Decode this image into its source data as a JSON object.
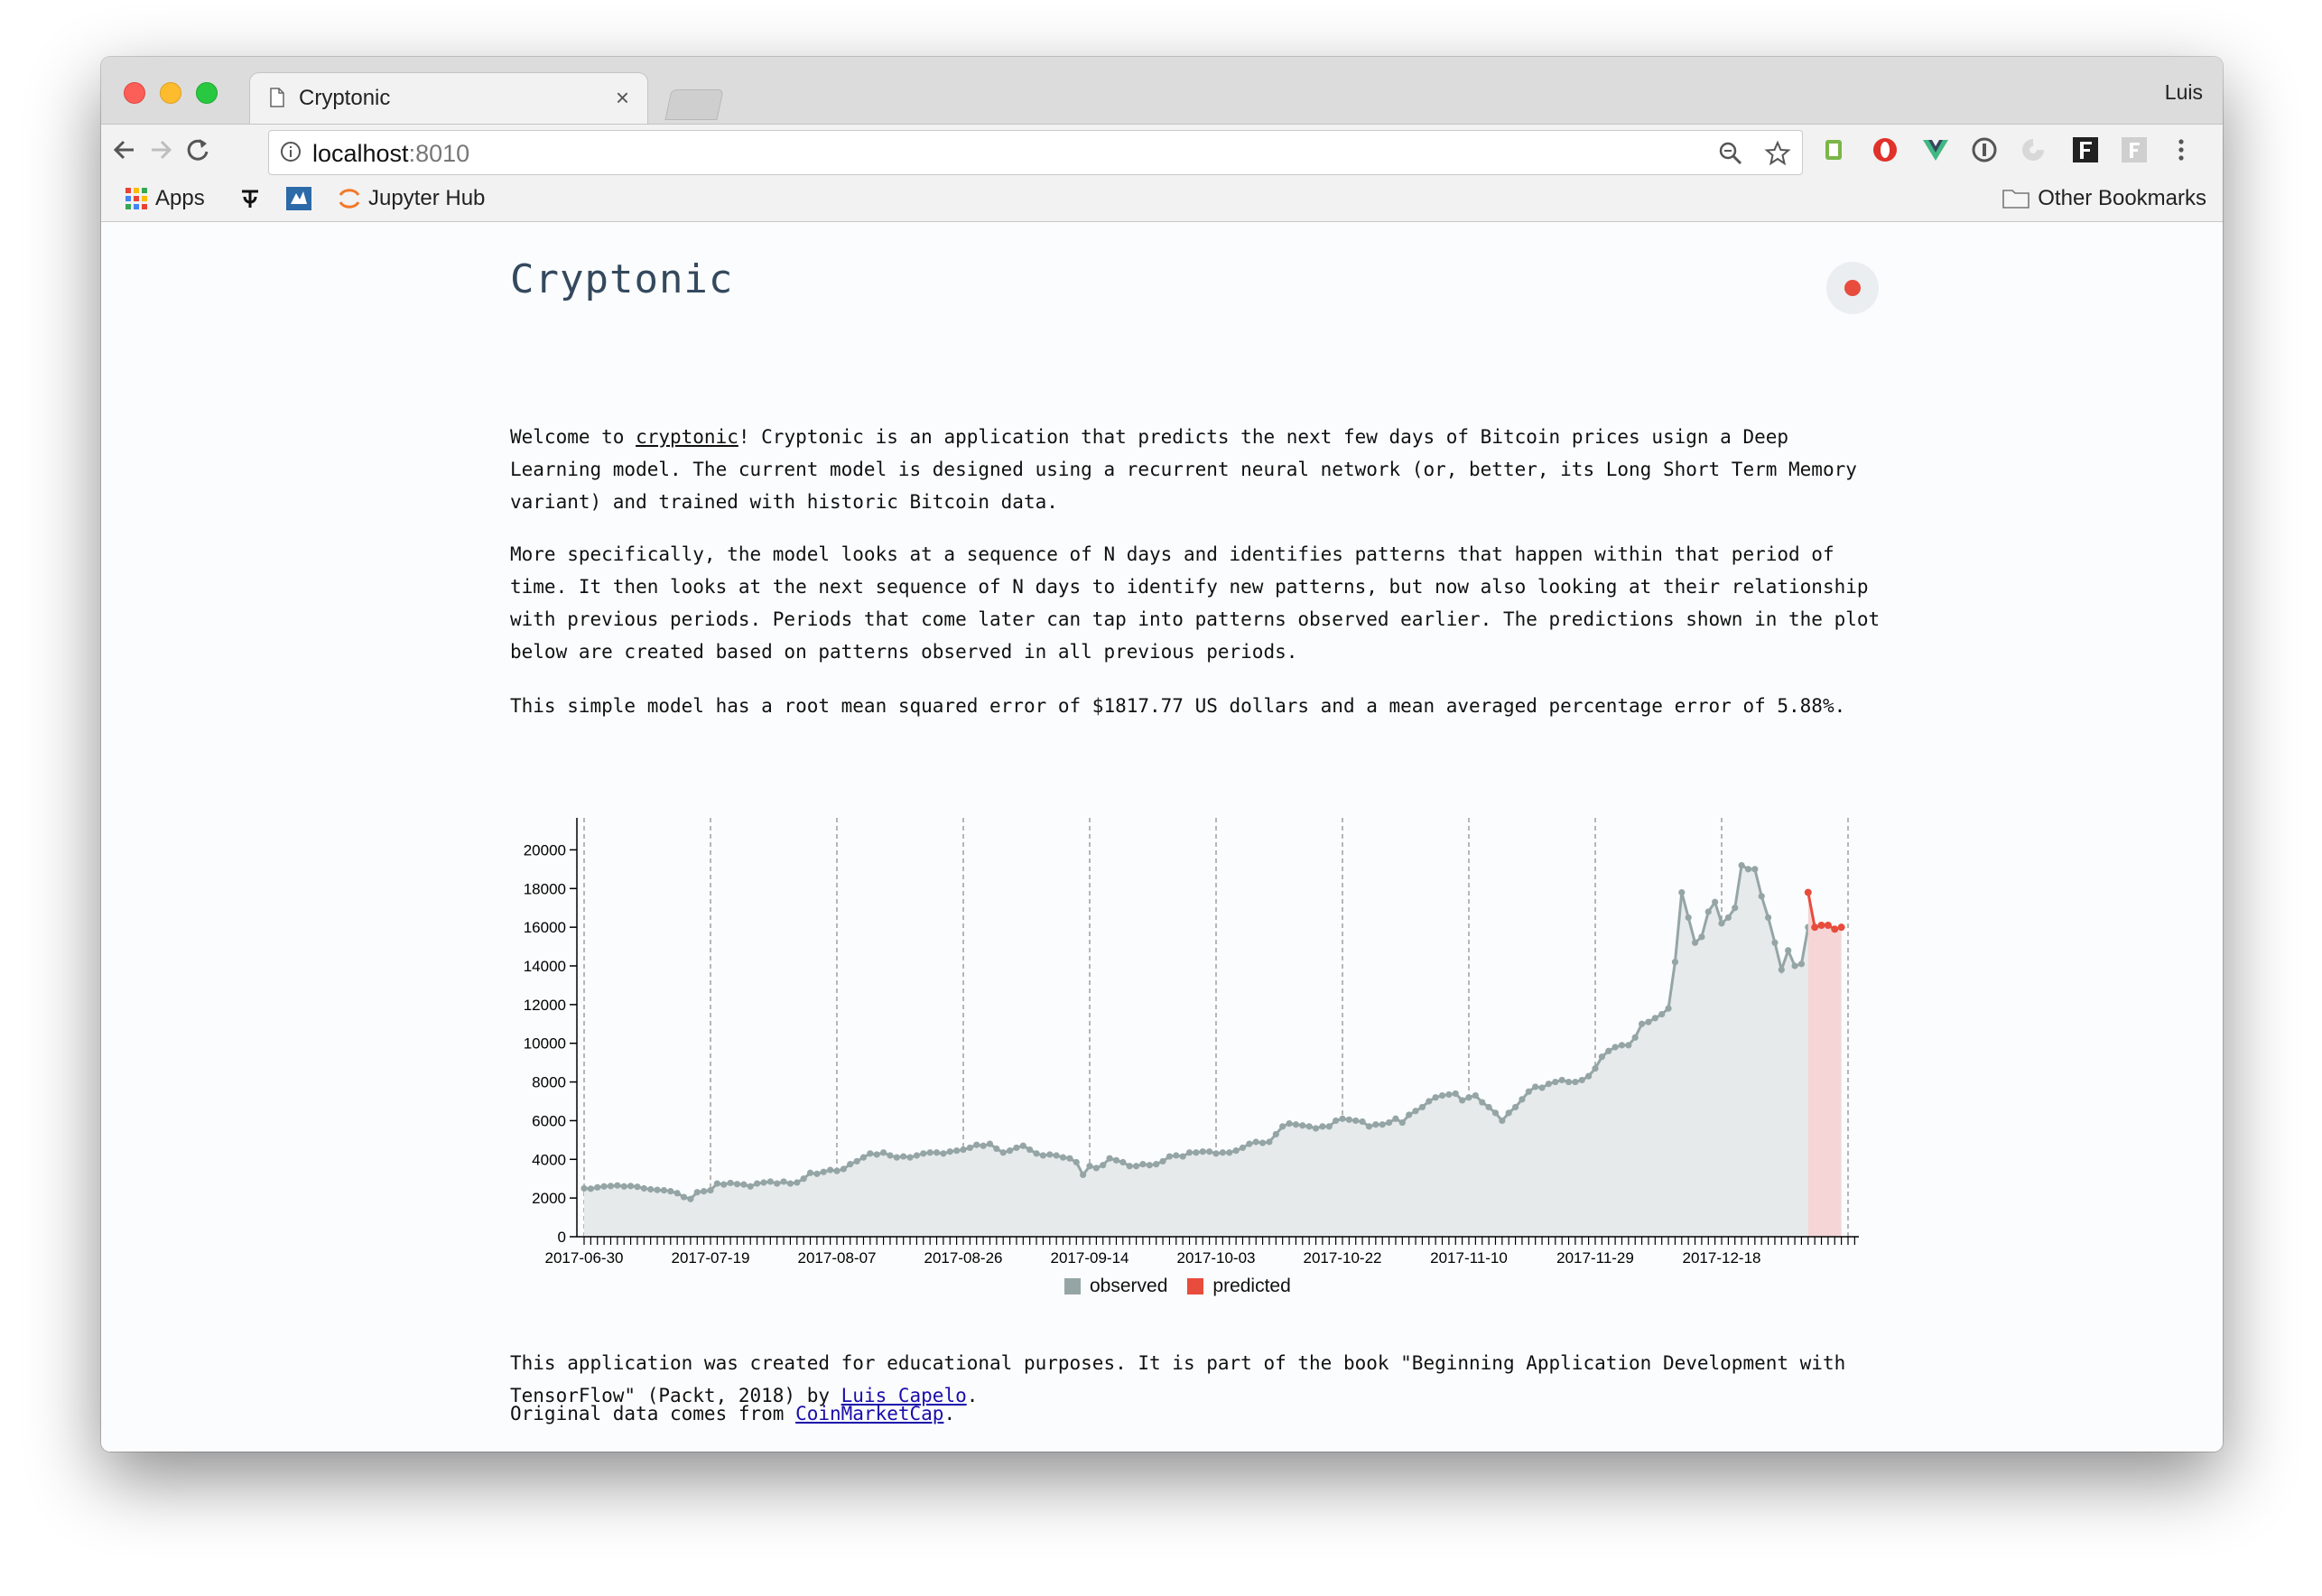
{
  "browser": {
    "tab_title": "Cryptonic",
    "tab_close": "×",
    "profile": "Luis",
    "url_host": "localhost",
    "url_port": ":8010",
    "bookmarks": {
      "apps": "Apps",
      "jupyter": "Jupyter Hub",
      "other": "Other Bookmarks"
    }
  },
  "page": {
    "title": "Cryptonic",
    "p1_welcome": "Welcome to ",
    "p1_link": "cryptonic",
    "p1_rest": "! Cryptonic is an application that predicts the next few days of Bitcoin prices usign a Deep Learning model. The current model is designed using a recurrent neural network (or, better, its Long Short Term Memory variant) and trained with historic Bitcoin data.",
    "p2": "More specifically, the model looks at a sequence of N days and identifies patterns that happen within that period of time. It then looks at the next sequence of N days to identify new patterns, but now also looking at their relationship with previous periods. Periods that come later can tap into patterns observed earlier. The predictions shown in the plot below are created based on patterns observed in all previous periods.",
    "p3": "This simple model has a root mean squared error of $1817.77 US dollars and a mean averaged percentage error of 5.88%.",
    "p4_text": "This application was created for educational purposes. It is part of the book \"Beginning Application Development with TensorFlow\" (Packt, 2018) by ",
    "p4_link": "Luis Capelo",
    "p4_end": ".",
    "p5_text": "Original data comes from ",
    "p5_link": "CoinMarketCap",
    "p5_end": "."
  },
  "chart_data": {
    "type": "area",
    "ylim": [
      0,
      21000
    ],
    "yticks": [
      0,
      2000,
      4000,
      6000,
      8000,
      10000,
      12000,
      14000,
      16000,
      18000,
      20000
    ],
    "xticks": [
      "2017-06-30",
      "2017-07-19",
      "2017-08-07",
      "2017-08-26",
      "2017-09-14",
      "2017-10-03",
      "2017-10-22",
      "2017-11-10",
      "2017-11-29",
      "2017-12-18"
    ],
    "x_start": "2017-06-30",
    "legend": [
      "observed",
      "predicted"
    ],
    "colors": {
      "observed": "#95a5a6",
      "observed_fill": "#e6eaeb",
      "predicted": "#e74c3c",
      "predicted_fill": "#f5d5d5"
    },
    "observed": [
      2500,
      2480,
      2550,
      2600,
      2620,
      2650,
      2600,
      2620,
      2580,
      2500,
      2450,
      2420,
      2400,
      2350,
      2250,
      2050,
      1950,
      2300,
      2350,
      2400,
      2750,
      2700,
      2780,
      2720,
      2700,
      2600,
      2750,
      2800,
      2850,
      2750,
      2850,
      2750,
      2800,
      3000,
      3300,
      3250,
      3350,
      3450,
      3400,
      3500,
      3750,
      3900,
      4100,
      4300,
      4250,
      4350,
      4200,
      4100,
      4150,
      4100,
      4200,
      4300,
      4350,
      4350,
      4300,
      4400,
      4450,
      4500,
      4600,
      4750,
      4700,
      4800,
      4550,
      4350,
      4450,
      4600,
      4700,
      4500,
      4300,
      4200,
      4250,
      4200,
      4100,
      4050,
      3850,
      3200,
      3650,
      3550,
      3700,
      4050,
      3950,
      3850,
      3650,
      3650,
      3750,
      3700,
      3750,
      3900,
      4150,
      4200,
      4150,
      4350,
      4350,
      4400,
      4400,
      4300,
      4350,
      4350,
      4450,
      4600,
      4800,
      4900,
      4850,
      4900,
      5300,
      5700,
      5850,
      5800,
      5750,
      5700,
      5600,
      5700,
      5700,
      6000,
      6100,
      6050,
      6000,
      5950,
      5700,
      5800,
      5800,
      5900,
      6100,
      5900,
      6300,
      6500,
      6700,
      7000,
      7200,
      7300,
      7350,
      7400,
      7050,
      7200,
      7300,
      6950,
      6700,
      6400,
      6000,
      6400,
      6700,
      7100,
      7500,
      7750,
      7700,
      7900,
      8000,
      8100,
      8000,
      8000,
      8100,
      8300,
      8700,
      9300,
      9600,
      9800,
      9900,
      9900,
      10300,
      11000,
      11100,
      11300,
      11500,
      11800,
      14200,
      17800,
      16500,
      15200,
      15500,
      16800,
      17300,
      16200,
      16500,
      17000,
      19200,
      19000,
      19000,
      17600,
      16500,
      15200,
      13800,
      14800,
      14000,
      14100,
      16000
    ],
    "predicted": [
      17800,
      16000,
      16100,
      16100,
      15900,
      16000
    ]
  }
}
